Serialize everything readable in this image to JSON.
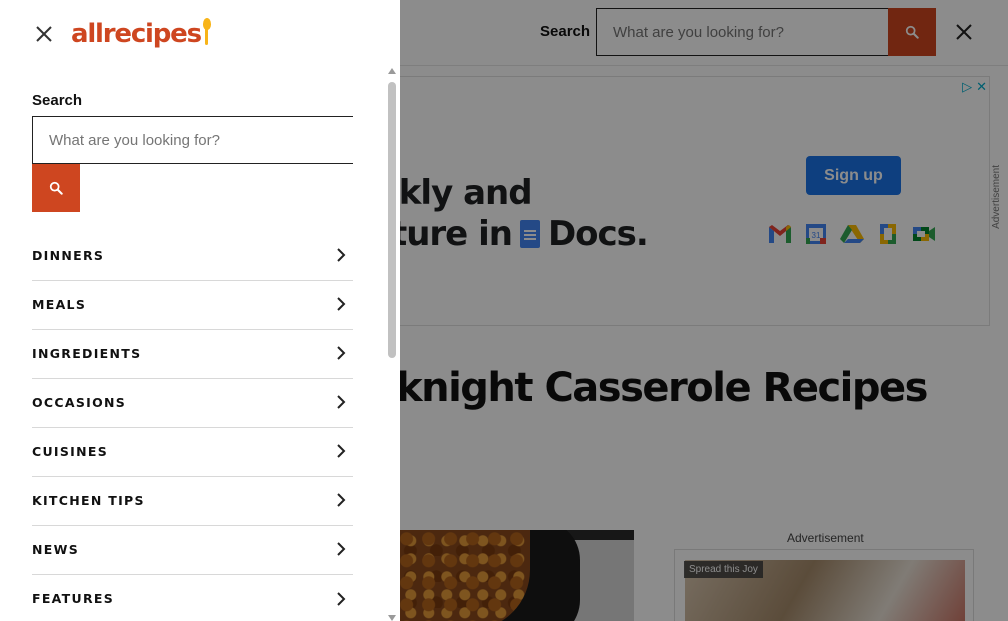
{
  "background": {
    "header": {
      "search_label": "Search",
      "search_placeholder": "What are you looking for?"
    },
    "ad_banner": {
      "line1": "ickly and",
      "line2_text": "ature in",
      "docs_text": "Docs.",
      "signup_label": "Sign up",
      "side_label": "Advertisement",
      "app_icons": [
        "gmail-icon",
        "calendar-icon",
        "drive-icon",
        "docs-icon",
        "meet-icon"
      ]
    },
    "page_heading": "knight Casserole Recipes",
    "ad_label": "Advertisement",
    "ad_tag": "Spread this Joy"
  },
  "drawer": {
    "brand": "allrecipes",
    "search_label": "Search",
    "search_placeholder": "What are you looking for?",
    "nav": [
      {
        "label": "DINNERS"
      },
      {
        "label": "MEALS"
      },
      {
        "label": "INGREDIENTS"
      },
      {
        "label": "OCCASIONS"
      },
      {
        "label": "CUISINES"
      },
      {
        "label": "KITCHEN TIPS"
      },
      {
        "label": "NEWS"
      },
      {
        "label": "FEATURES"
      }
    ]
  },
  "colors": {
    "brand_orange": "#ce4620",
    "spoon_yellow": "#f8b418",
    "overlay": "rgba(0,0,0,0.45)"
  }
}
